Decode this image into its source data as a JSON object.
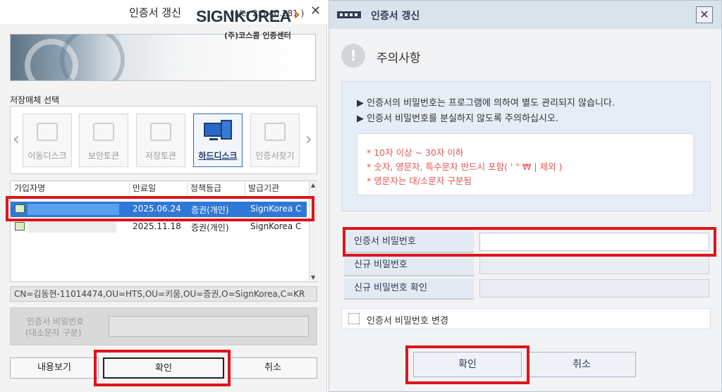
{
  "left_dialog": {
    "title": "인증서 갱신",
    "version": "( Ver 2.5.40.281 )",
    "close_glyph": "✕",
    "banner": {
      "brand": "SIGNKOREA",
      "brand_arrow": "›",
      "brand_sub": "(주)코스콤 인증센터",
      "brand_arrow_color": "#e86a1d"
    },
    "storage_label": "저장매체 선택",
    "nav_prev": "‹",
    "nav_next": "›",
    "media": [
      {
        "label": "이동디스크",
        "icon": "usb-drive-icon",
        "active": false
      },
      {
        "label": "보안토큰",
        "icon": "security-token-icon",
        "active": false
      },
      {
        "label": "저장토큰",
        "icon": "storage-token-icon",
        "active": false
      },
      {
        "label": "하드디스크",
        "icon": "hard-disk-monitor-icon",
        "active": true
      },
      {
        "label": "인증서찾기",
        "icon": "find-certificate-icon",
        "active": false
      }
    ],
    "table": {
      "columns": [
        "가입자명",
        "만료일",
        "정책등급",
        "발급기관"
      ],
      "rows": [
        {
          "expiry": "2025.06.24",
          "policy": "증권(개인)",
          "issuer": "SignKorea C",
          "selected": true
        },
        {
          "expiry": "2025.11.18",
          "policy": "증권(개인)",
          "issuer": "SignKorea C",
          "selected": false
        }
      ]
    },
    "dn": "CN=김동현-11014474,OU=HTS,OU=키움,OU=증권,O=SignKorea,C=KR",
    "password_label_1": "인증서 비밀번호",
    "password_label_2": "(대소문자 구분)",
    "buttons": {
      "view": "내용보기",
      "ok": "확인",
      "cancel": "취소"
    },
    "highlight_color": "#e0141b"
  },
  "right_dialog": {
    "title": "인증서 갱신",
    "close_glyph": "✕",
    "notice_icon": "!",
    "notice_title": "주의사항",
    "notices": [
      "▶ 인증서의 비밀번호는 프로그램에 의하여 별도 관리되지 않습니다.",
      "▶ 인증서 비밀번호를 분실하지 않도록 주의하십시오."
    ],
    "rules": [
      "* 10자 이상 ~ 30자 이하",
      "* 숫자, 영문자, 특수문자 반드시 포함( ' \" ₩ | 제외 )",
      "* 영문자는 대/소문자 구분됨"
    ],
    "fields": {
      "current": "인증서 비밀번호",
      "new": "신규 비밀번호",
      "confirm": "신규 비밀번호 확인"
    },
    "change_checkbox_label": "인증서 비밀번호 변경",
    "buttons": {
      "ok": "확인",
      "cancel": "취소"
    },
    "rule_color": "#e0564f"
  }
}
